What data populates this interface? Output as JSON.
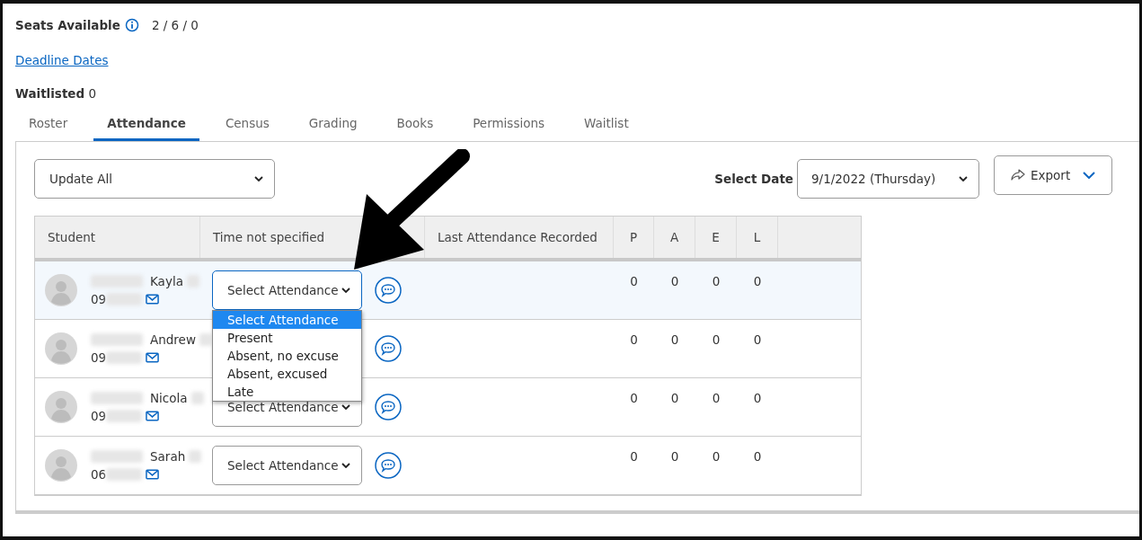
{
  "seats": {
    "label": "Seats Available",
    "value": "2 / 6 / 0"
  },
  "deadline_link": "Deadline Dates",
  "waitlisted": {
    "label": "Waitlisted",
    "value": "0"
  },
  "tabs": [
    {
      "label": "Roster",
      "selected": false
    },
    {
      "label": "Attendance",
      "selected": true
    },
    {
      "label": "Census",
      "selected": false
    },
    {
      "label": "Grading",
      "selected": false
    },
    {
      "label": "Books",
      "selected": false
    },
    {
      "label": "Permissions",
      "selected": false
    },
    {
      "label": "Waitlist",
      "selected": false
    }
  ],
  "toolbar": {
    "update_all": "Update All",
    "date_label": "Select Date",
    "date_value": "9/1/2022 (Thursday)",
    "export": "Export"
  },
  "table": {
    "columns": [
      "Student",
      "Time not specified",
      "Last Attendance Recorded",
      "P",
      "A",
      "E",
      "L"
    ],
    "rows": [
      {
        "name": "Kayla",
        "id": "09",
        "selected": true,
        "attendance": "Select Attendance",
        "counts": [
          "0",
          "0",
          "0",
          "0"
        ]
      },
      {
        "name": "Andrew",
        "id": "09",
        "selected": false,
        "counts": [
          "0",
          "0",
          "0",
          "0"
        ]
      },
      {
        "name": "Nicola",
        "id": "09",
        "selected": false,
        "attendance": "Select Attendance",
        "counts": [
          "0",
          "0",
          "0",
          "0"
        ]
      },
      {
        "name": "Sarah",
        "id": "06",
        "selected": false,
        "attendance": "Select Attendance",
        "counts": [
          "0",
          "0",
          "0",
          "0"
        ]
      }
    ]
  },
  "dropdown": {
    "options": [
      {
        "label": "Select Attendance",
        "selected": true
      },
      {
        "label": "Present",
        "selected": false
      },
      {
        "label": "Absent, no excuse",
        "selected": false
      },
      {
        "label": "Absent, excused",
        "selected": false
      },
      {
        "label": "Late",
        "selected": false
      }
    ]
  }
}
